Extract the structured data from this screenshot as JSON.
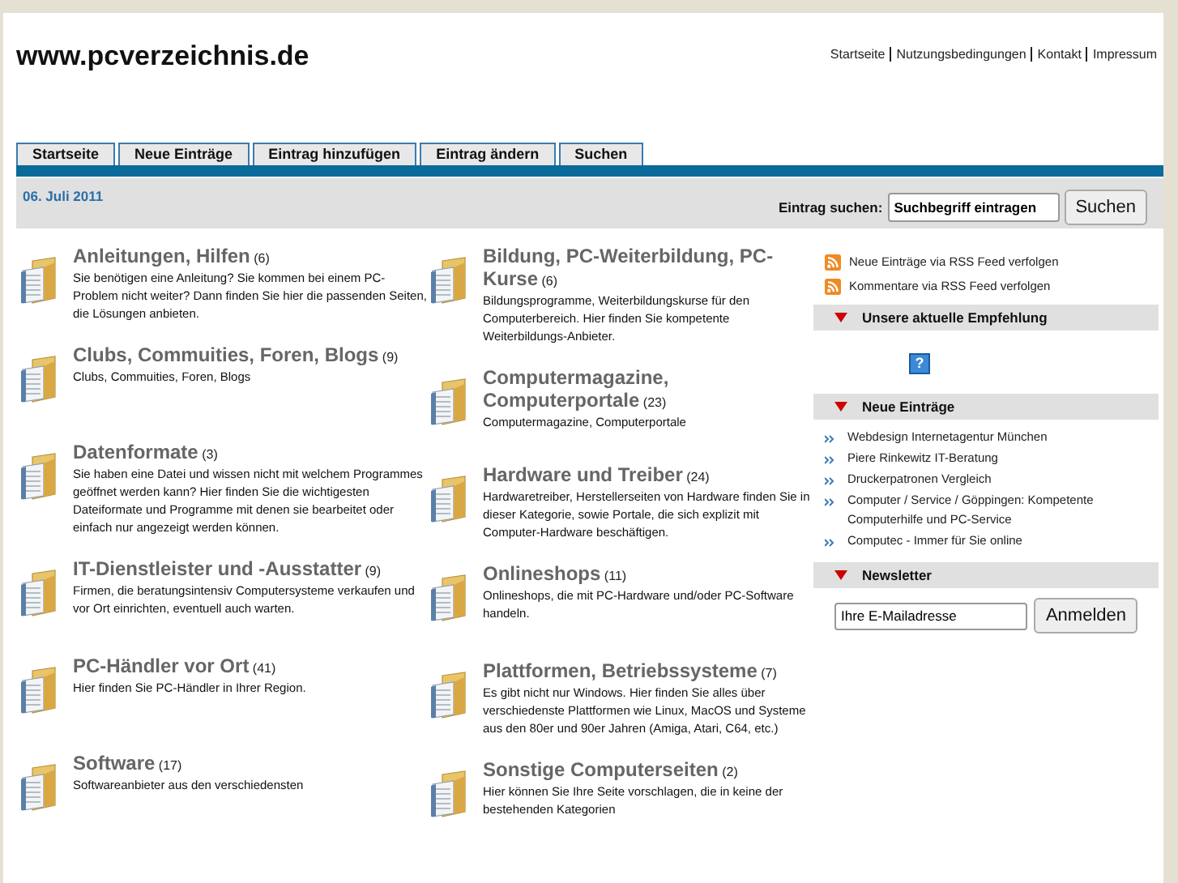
{
  "site_title": "www.pcverzeichnis.de",
  "top_links": [
    "Startseite",
    "Nutzungsbedingungen",
    "Kontakt",
    "Impressum"
  ],
  "tabs": [
    {
      "label": "Startseite",
      "selected": false
    },
    {
      "label": "Neue Einträge",
      "selected": false
    },
    {
      "label": "Eintrag hinzufügen",
      "selected": false
    },
    {
      "label": "Eintrag ändern",
      "selected": false
    },
    {
      "label": "Suchen",
      "selected": false
    }
  ],
  "date": "06. Juli 2011",
  "search": {
    "label": "Eintrag suchen:",
    "value": "Suchbegriff eintragen",
    "button": "Suchen"
  },
  "categories_left": [
    {
      "title": "Anleitungen, Hilfen",
      "count": "(6)",
      "description": "Sie benötigen eine Anleitung? Sie kommen bei einem PC-Problem nicht weiter? Dann finden Sie hier die passenden Seiten, die Lösungen anbieten."
    },
    {
      "title": "Clubs, Commuities, Foren, Blogs",
      "count": "(9)",
      "description": "Clubs, Commuities, Foren, Blogs"
    },
    {
      "title": "Datenformate",
      "count": "(3)",
      "description": "Sie haben eine Datei und wissen nicht mit welchem Programmes geöffnet werden kann? Hier finden Sie die wichtigesten Dateiformate und Programme mit denen sie bearbeitet oder einfach nur angezeigt werden können."
    },
    {
      "title": "IT-Dienstleister und -Ausstatter",
      "count": "(9)",
      "description": "Firmen, die beratungsintensiv Computersysteme verkaufen und vor Ort einrichten, eventuell auch warten."
    },
    {
      "title": "PC-Händler vor Ort",
      "count": "(41)",
      "description": "Hier finden Sie PC-Händler in Ihrer Region."
    },
    {
      "title": "Software",
      "count": "(17)",
      "description": "Softwareanbieter aus den verschiedensten"
    }
  ],
  "categories_right": [
    {
      "title": "Bildung, PC-Weiterbildung, PC-Kurse",
      "count": "(6)",
      "description": "Bildungsprogramme, Weiterbildungskurse für den Computerbereich. Hier finden Sie kompetente Weiterbildungs-Anbieter."
    },
    {
      "title": "Computermagazine, Computerportale",
      "count": "(23)",
      "description": "Computermagazine, Computerportale"
    },
    {
      "title": "Hardware und Treiber",
      "count": "(24)",
      "description": "Hardwaretreiber, Herstellerseiten von Hardware finden Sie in dieser Kategorie, sowie Portale, die sich explizit mit Computer-Hardware beschäftigen."
    },
    {
      "title": "Onlineshops",
      "count": "(11)",
      "description": "Onlineshops, die mit PC-Hardware und/oder PC-Software handeln."
    },
    {
      "title": "Plattformen, Betriebssysteme",
      "count": "(7)",
      "description": "Es gibt nicht nur Windows. Hier finden Sie alles über verschiedenste Plattformen wie Linux, MacOS und Systeme aus den 80er und 90er Jahren (Amiga, Atari, C64, etc.)"
    },
    {
      "title": "Sonstige Computerseiten",
      "count": "(2)",
      "description": "Hier können Sie Ihre Seite vorschlagen, die in keine der bestehenden Kategorien"
    }
  ],
  "sidebar": {
    "feeds": [
      "Neue Einträge via RSS Feed verfolgen",
      "Kommentare via RSS Feed verfolgen"
    ],
    "recommendation_heading": "Unsere aktuelle Empfehlung",
    "recommendation_icon": "?",
    "new_entries_heading": "Neue Einträge",
    "new_entries": [
      "Webdesign Internetagentur München",
      "Piere Rinkewitz IT-Beratung",
      "Druckerpatronen Vergleich",
      "Computer / Service / Göppingen: Kompetente Computerhilfe und PC-Service",
      "Computec - Immer für Sie online"
    ],
    "newsletter_heading": "Newsletter",
    "newsletter": {
      "value": "Ihre E-Mailadresse",
      "button": "Anmelden"
    }
  }
}
